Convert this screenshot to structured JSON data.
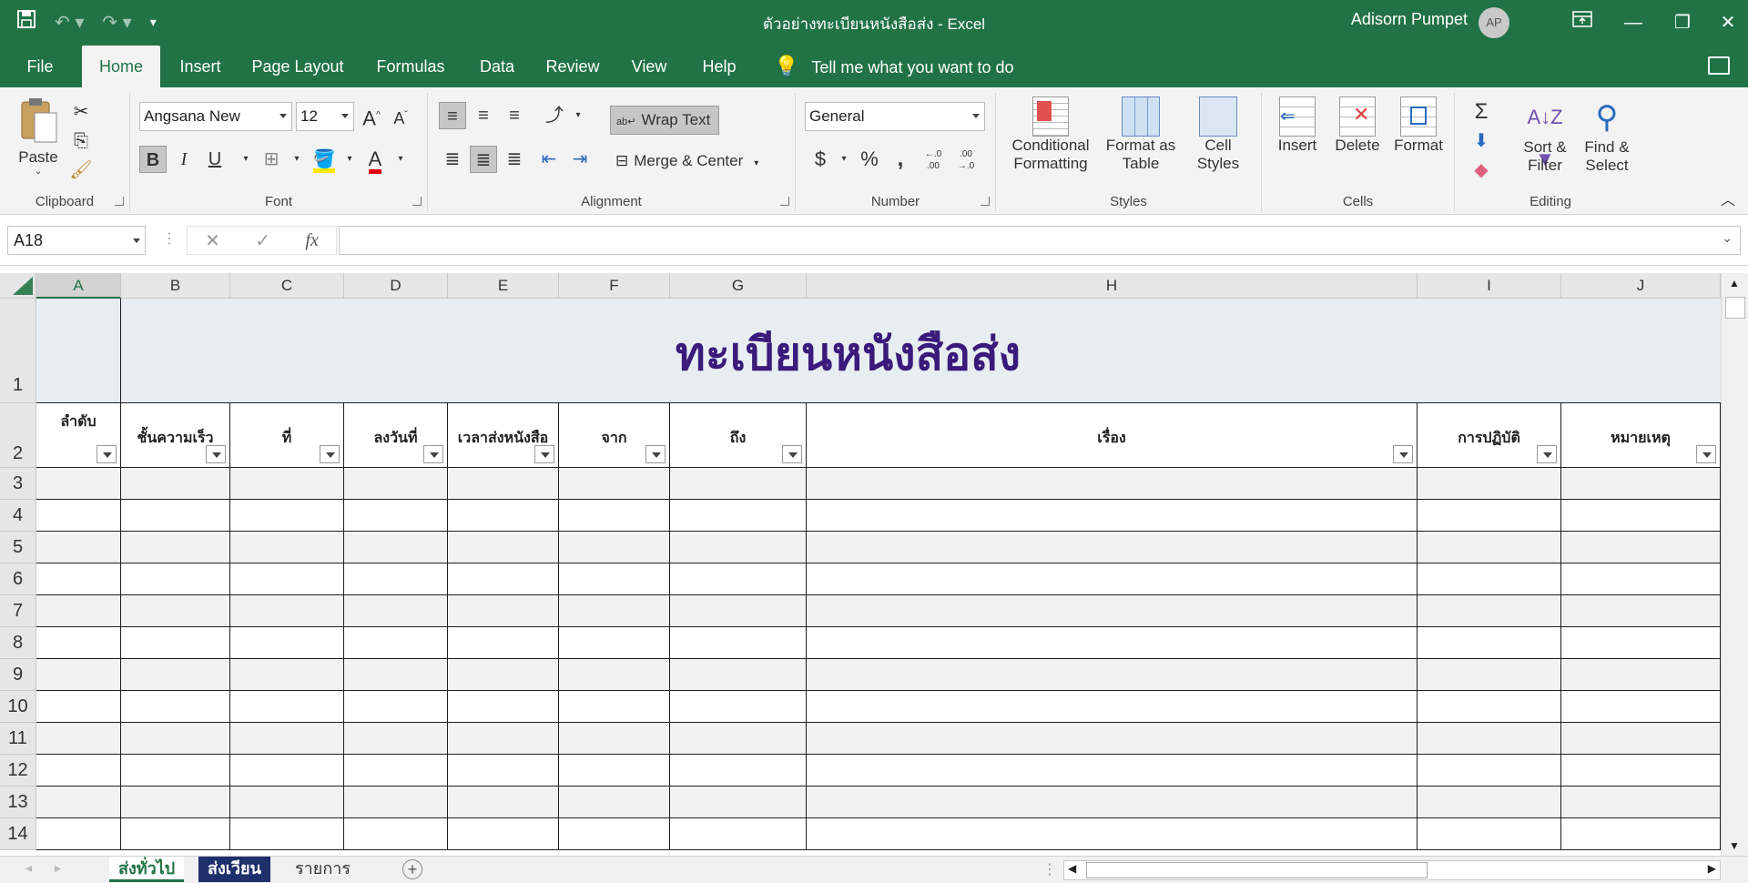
{
  "window": {
    "title": "ตัวอย่างทะเบียนหนังสือส่ง  -  Excel",
    "user_name": "Adisorn Pumpet",
    "user_initials": "AP"
  },
  "tabs": [
    "File",
    "Home",
    "Insert",
    "Page Layout",
    "Formulas",
    "Data",
    "Review",
    "View",
    "Help"
  ],
  "active_tab": "Home",
  "tell_me": "Tell me what you want to do",
  "ribbon": {
    "clipboard": {
      "label": "Clipboard",
      "paste": "Paste"
    },
    "font": {
      "label": "Font",
      "name": "Angsana New",
      "size": "12",
      "bold": "B",
      "italic": "I",
      "underline": "U",
      "grow": "A",
      "shrink": "A",
      "font_color_letter": "A"
    },
    "alignment": {
      "label": "Alignment",
      "wrap_text": "Wrap Text",
      "merge_center": "Merge & Center"
    },
    "number": {
      "label": "Number",
      "format": "General",
      "currency": "$",
      "percent": "%",
      "comma": ",",
      "inc_decimal": "←.0 .00",
      "dec_decimal": ".00 →.0"
    },
    "styles": {
      "label": "Styles",
      "conditional_formatting_1": "Conditional",
      "conditional_formatting_2": "Formatting",
      "format_as_table_1": "Format as",
      "format_as_table_2": "Table",
      "cell_styles_1": "Cell",
      "cell_styles_2": "Styles"
    },
    "cells": {
      "label": "Cells",
      "insert": "Insert",
      "delete": "Delete",
      "format": "Format"
    },
    "editing": {
      "label": "Editing",
      "sort_filter_1": "Sort &",
      "sort_filter_2": "Filter",
      "find_select_1": "Find &",
      "find_select_2": "Select"
    }
  },
  "formula_bar": {
    "name_box": "A18",
    "fx": "fx",
    "cancel": "✕",
    "enter": "✓",
    "content": ""
  },
  "columns": [
    "A",
    "B",
    "C",
    "D",
    "E",
    "F",
    "G",
    "H",
    "I",
    "J"
  ],
  "selected_column": "A",
  "rows": [
    "1",
    "2",
    "3",
    "4",
    "5",
    "6",
    "7",
    "8",
    "9",
    "10",
    "11",
    "12",
    "13",
    "14"
  ],
  "sheet_title": "ทะเบียนหนังสือส่ง",
  "table_headers": [
    "ลำดับ",
    "ชั้นความเร็ว",
    "ที่",
    "ลงวันที่",
    "เวลาส่งหนังสือ",
    "จาก",
    "ถึง",
    "เรื่อง",
    "การปฏิบัติ",
    "หมายเหตุ"
  ],
  "sheet_tabs": [
    {
      "name": "ส่งทั่วไป",
      "state": "active",
      "color": "#217346"
    },
    {
      "name": "ส่งเวียน",
      "state": "colored",
      "color": "#1f2f6b"
    },
    {
      "name": "รายการ",
      "state": "normal",
      "color": ""
    }
  ],
  "colors": {
    "excel_green": "#217346",
    "title_text": "#3a1a7a",
    "title_bg": "#e8edf2"
  }
}
